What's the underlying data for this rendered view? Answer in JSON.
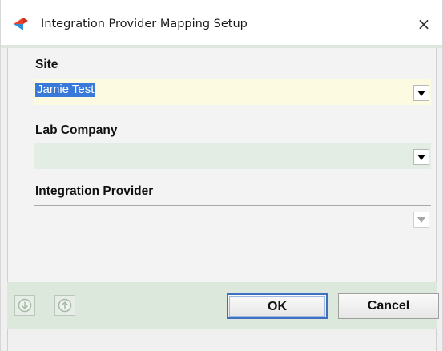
{
  "window": {
    "title": "Integration Provider Mapping Setup",
    "close_glyph": "×",
    "app_icon": "app-logo-icon",
    "close_icon": "close-icon"
  },
  "fields": {
    "site": {
      "label": "Site",
      "value": "Jamie Test"
    },
    "lab_company": {
      "label": "Lab Company",
      "value": ""
    },
    "integration_provider": {
      "label": "Integration Provider",
      "value": ""
    }
  },
  "buttons": {
    "ok_label": "OK",
    "cancel_label": "Cancel",
    "move_down_icon": "arrow-down-circle-icon",
    "move_up_icon": "arrow-up-circle-icon"
  },
  "colors": {
    "selection": "#3879d9",
    "site_field_bg": "#fcfbe2",
    "lab_field_bg": "#e4ede4",
    "button_bar_bg": "#dbe8db",
    "ok_border": "#3f6fbf"
  }
}
